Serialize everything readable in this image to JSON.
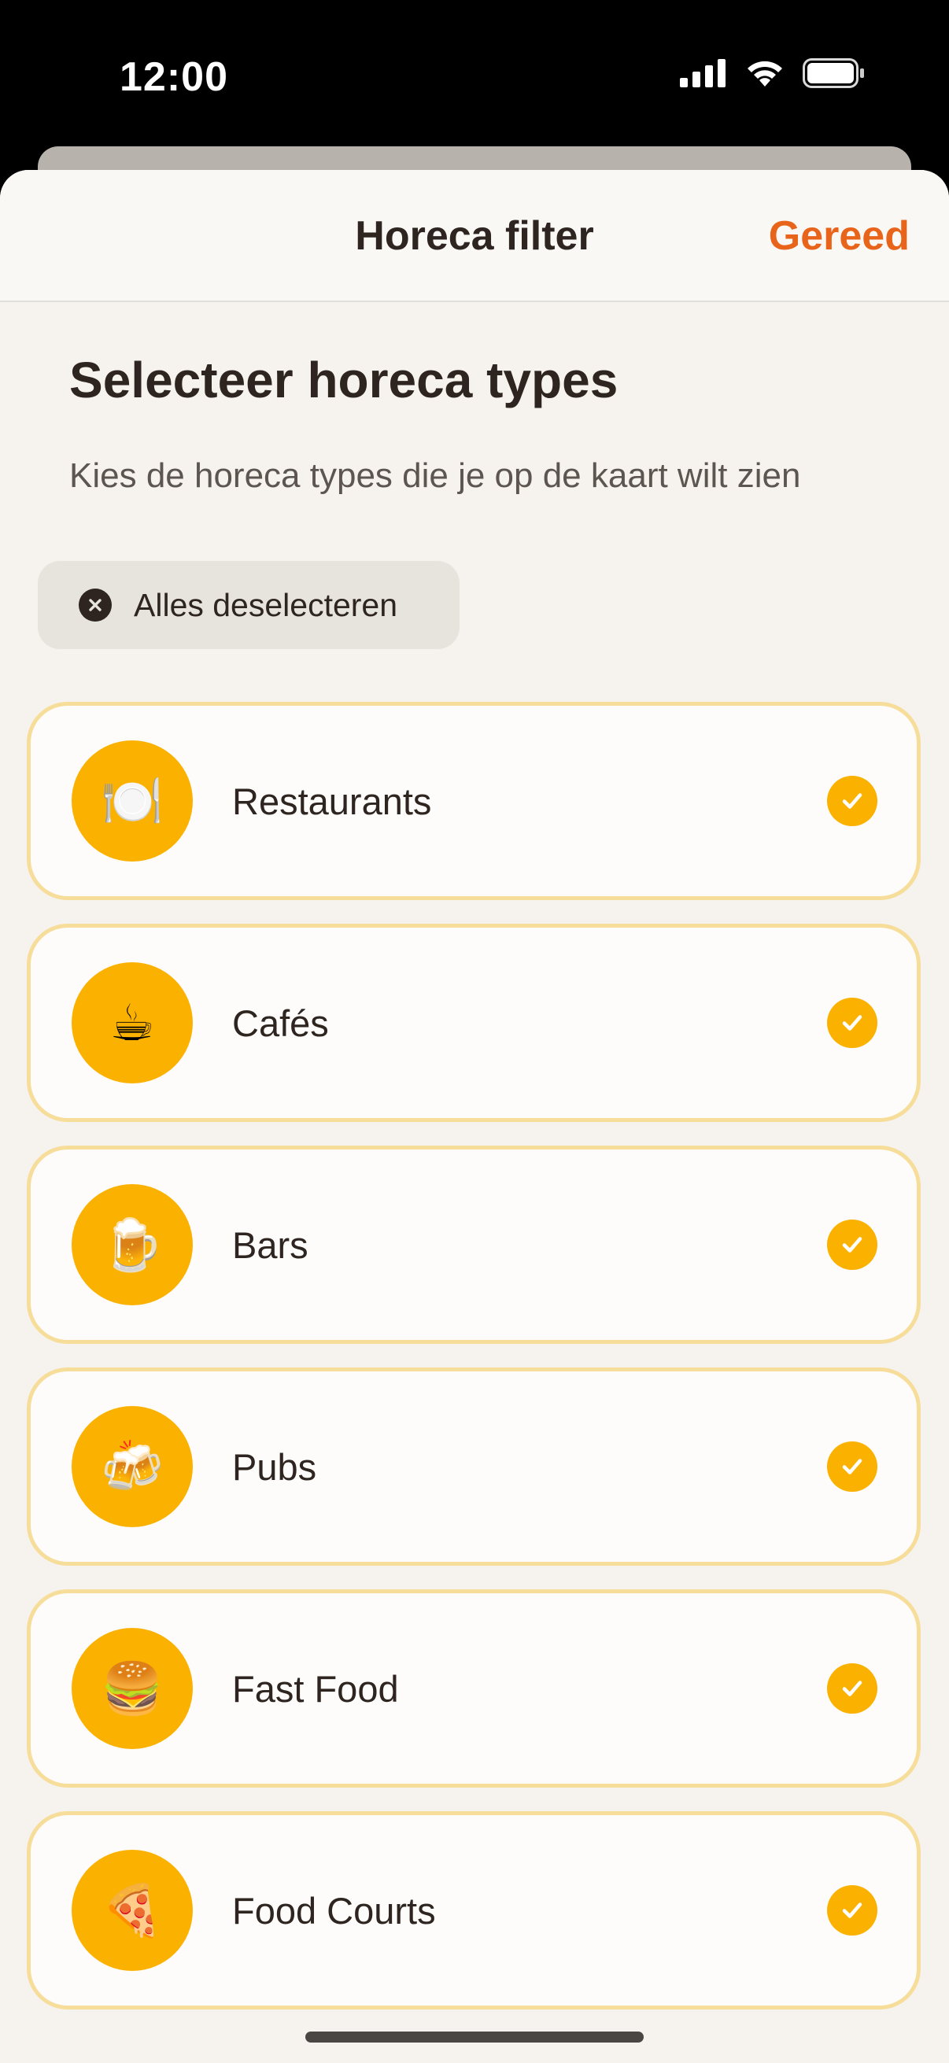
{
  "status_bar": {
    "time": "12:00",
    "icons": [
      "cellular-signal-icon",
      "wifi-icon",
      "battery-icon"
    ]
  },
  "nav": {
    "title": "Horeca filter",
    "done_label": "Gereed"
  },
  "header": {
    "title": "Selecteer horeca types",
    "subtitle": "Kies de horeca types die je op de kaart wilt zien"
  },
  "deselect_button": {
    "label": "Alles deselecteren",
    "icon": "x-circle-icon"
  },
  "items": [
    {
      "label": "Restaurants",
      "emoji": "🍽️",
      "icon": "plate-cutlery-icon",
      "selected": true
    },
    {
      "label": "Cafés",
      "emoji": "☕",
      "icon": "coffee-cup-icon",
      "selected": true
    },
    {
      "label": "Bars",
      "emoji": "🍺",
      "icon": "beer-mug-icon",
      "selected": true
    },
    {
      "label": "Pubs",
      "emoji": "🍻",
      "icon": "clinking-beers-icon",
      "selected": true
    },
    {
      "label": "Fast Food",
      "emoji": "🍔",
      "icon": "burger-icon",
      "selected": true
    },
    {
      "label": "Food Courts",
      "emoji": "🍕",
      "icon": "pizza-icon",
      "selected": true
    }
  ],
  "colors": {
    "accent": "#e8641b",
    "item_icon_bg": "#fbb100",
    "item_border": "#f7dd9a",
    "sheet_bg": "#f6f3ef",
    "text": "#2e2520"
  }
}
